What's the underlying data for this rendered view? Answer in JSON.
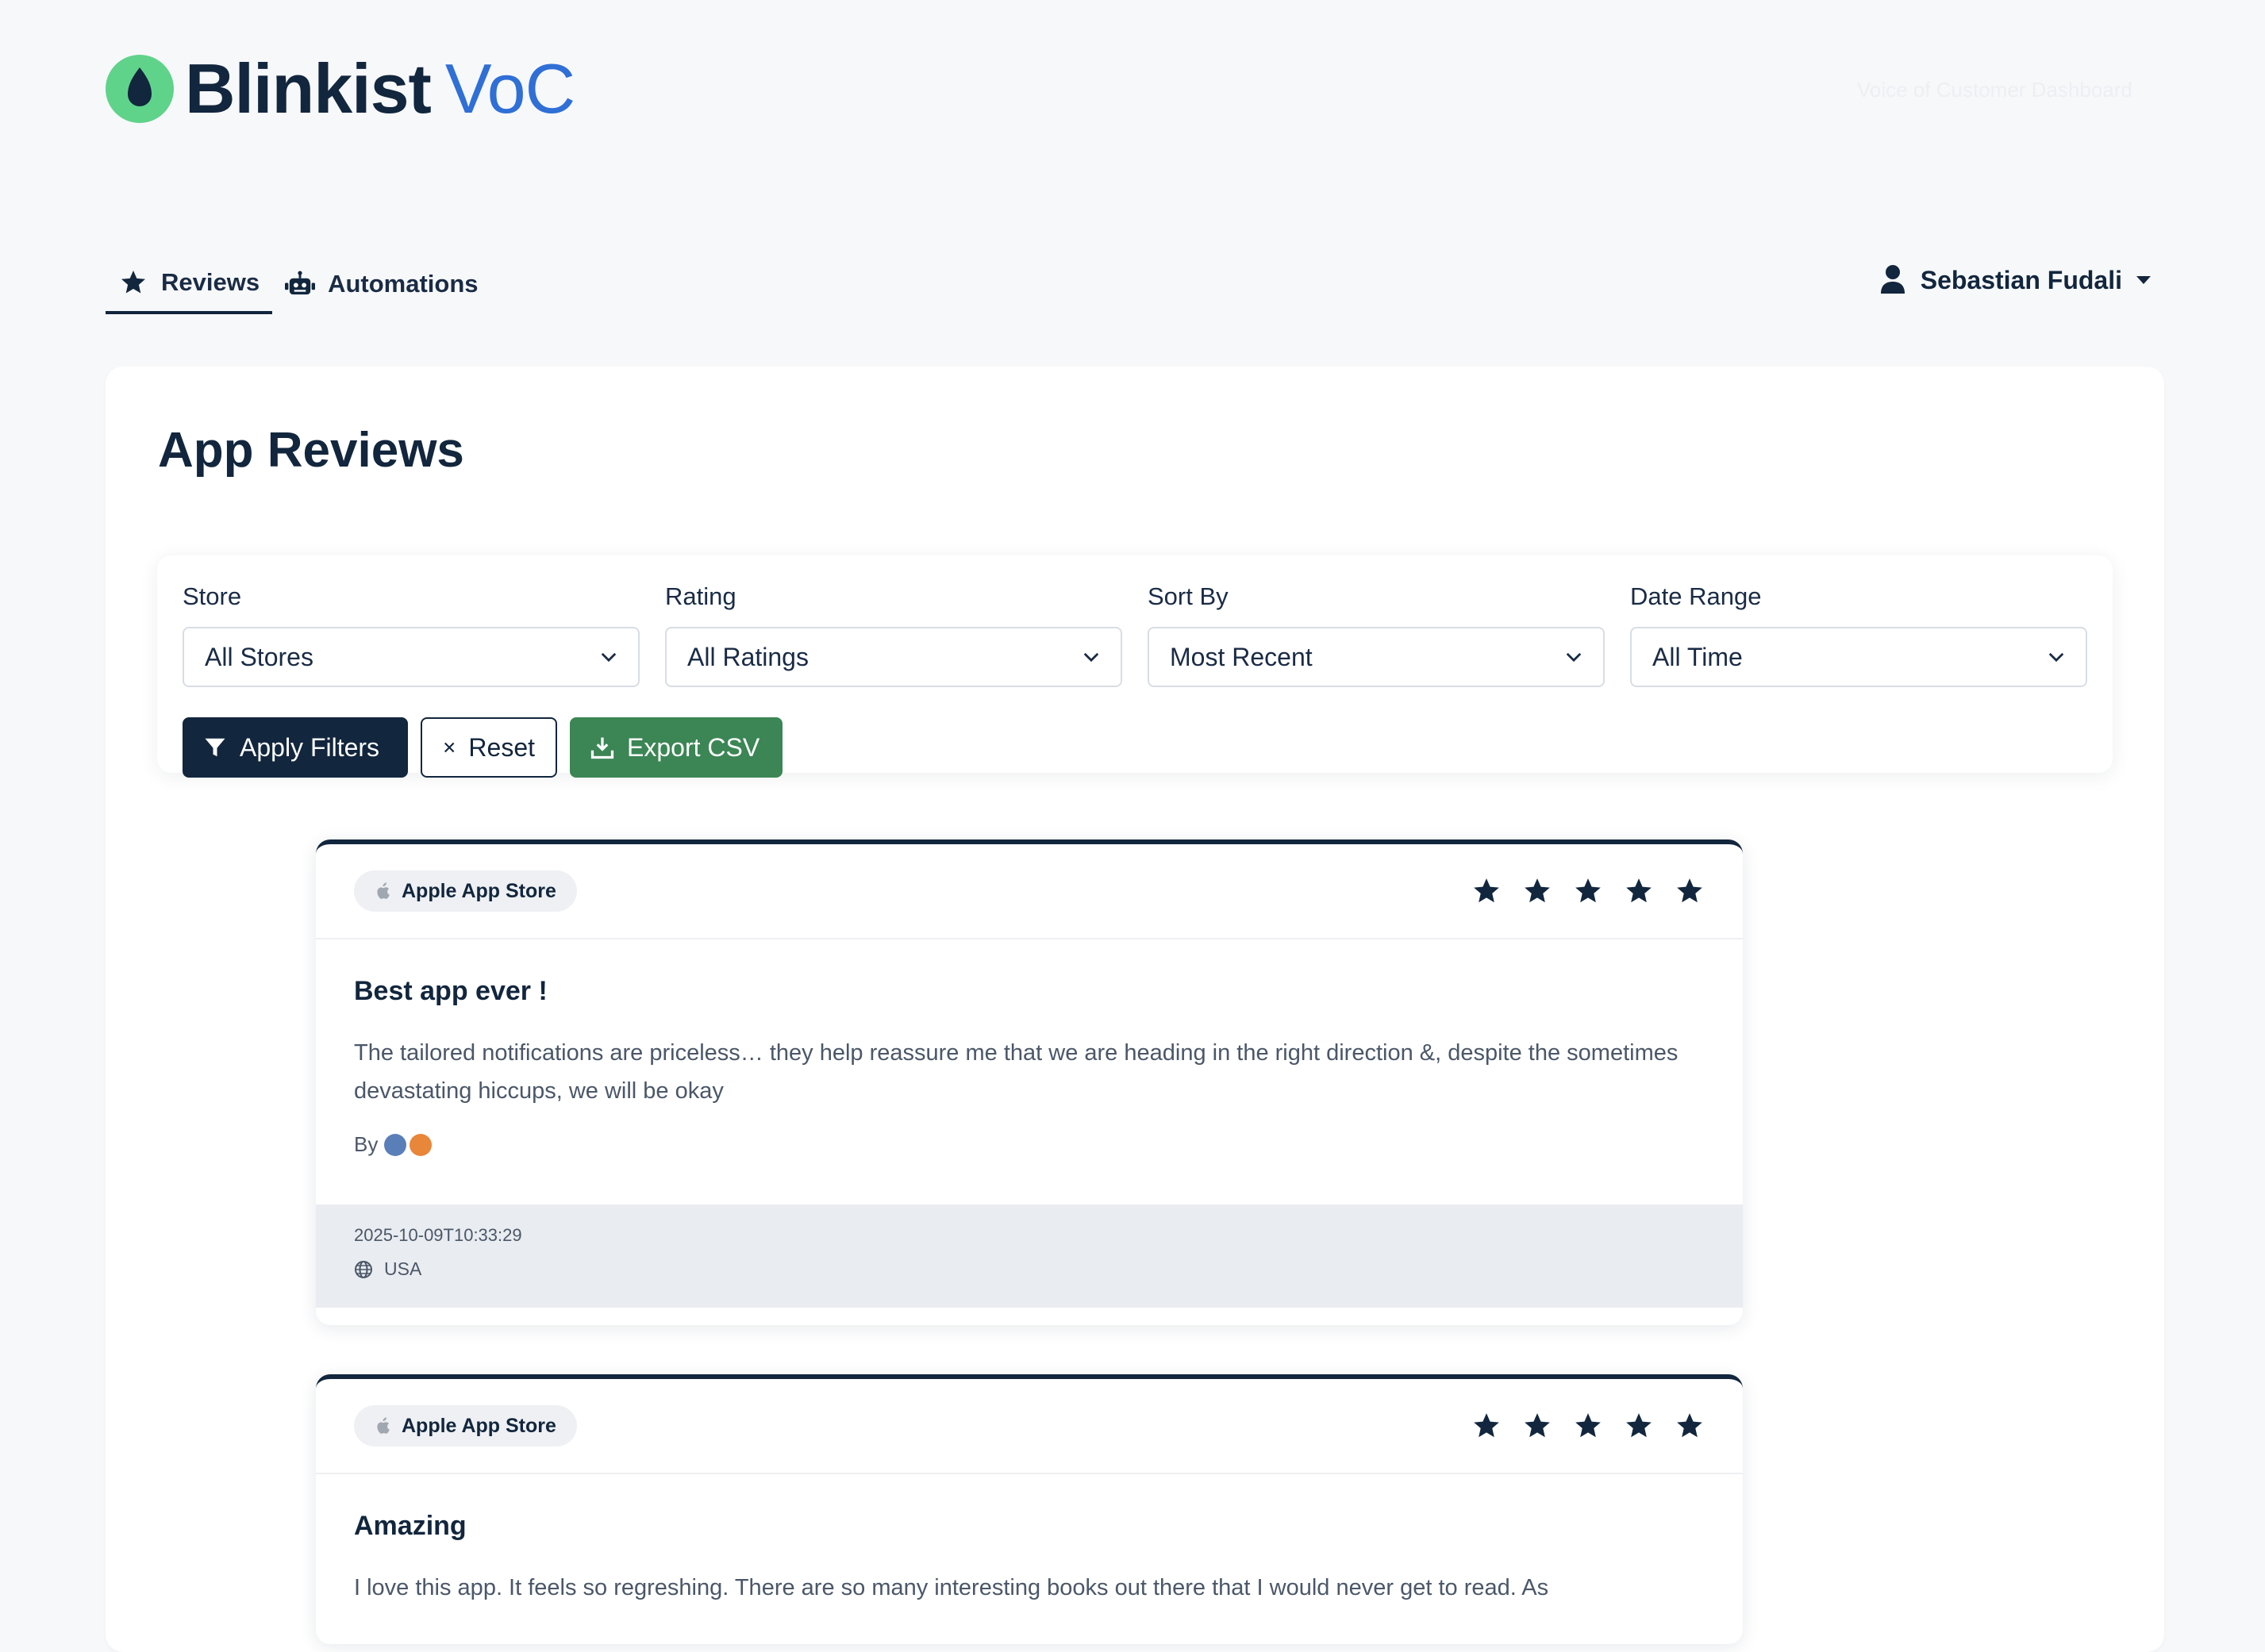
{
  "brand": {
    "name": "Blinkist",
    "suffix": "VoC",
    "tagline": "Voice of Customer Dashboard"
  },
  "colors": {
    "primary": "#12263d",
    "accent_blue": "#2f6fd6",
    "brand_green": "#5fd38a",
    "success": "#3b8654"
  },
  "nav": {
    "tabs": [
      {
        "label": "Reviews",
        "icon": "star-icon",
        "active": true
      },
      {
        "label": "Automations",
        "icon": "robot-icon",
        "active": false
      }
    ],
    "user": {
      "name": "Sebastian Fudali",
      "icon": "user-icon"
    }
  },
  "page": {
    "title": "App Reviews"
  },
  "filters": {
    "store": {
      "label": "Store",
      "value": "All Stores"
    },
    "rating": {
      "label": "Rating",
      "value": "All Ratings"
    },
    "sort": {
      "label": "Sort By",
      "value": "Most Recent"
    },
    "date_range": {
      "label": "Date Range",
      "value": "All Time"
    },
    "buttons": {
      "apply": "Apply Filters",
      "reset": "Reset",
      "export": "Export CSV"
    }
  },
  "reviews": [
    {
      "store": "Apple App Store",
      "rating": 5,
      "title": "Best app ever !",
      "text": "The tailored notifications are priceless… they help reassure me that we are heading in the right direction &, despite the sometimes devastating hiccups, we will be okay",
      "author_prefix": "By",
      "date": "2025-10-09T10:33:29",
      "country": "USA"
    },
    {
      "store": "Apple App Store",
      "rating": 5,
      "title": "Amazing",
      "text": "I love this app. It feels so regreshing. There are so many interesting books out there that I would never get to read. As"
    }
  ]
}
